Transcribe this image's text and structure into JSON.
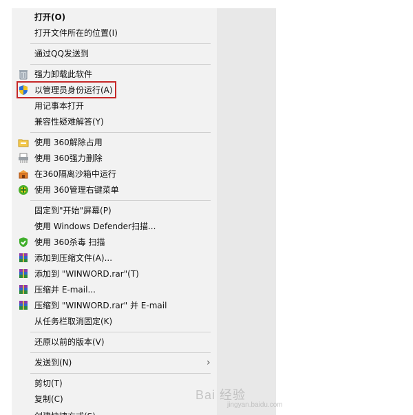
{
  "menu": {
    "items": [
      {
        "label": "打开(O)",
        "icon": "",
        "bold": true
      },
      {
        "label": "打开文件所在的位置(I)",
        "icon": ""
      },
      {
        "label": "通过QQ发送到",
        "icon": ""
      },
      {
        "label": "强力卸载此软件",
        "icon": "trash-icon"
      },
      {
        "label": "以管理员身份运行(A)",
        "icon": "uac-shield-icon"
      },
      {
        "label": "用记事本打开",
        "icon": ""
      },
      {
        "label": "兼容性疑难解答(Y)",
        "icon": ""
      },
      {
        "label": "使用 360解除占用",
        "icon": "folder-unlock-icon"
      },
      {
        "label": "使用 360强力删除",
        "icon": "shredder-icon"
      },
      {
        "label": "在360隔离沙箱中运行",
        "icon": "sandbox-icon"
      },
      {
        "label": "使用 360管理右键菜单",
        "icon": "menu-manager-icon"
      },
      {
        "label": "固定到\"开始\"屏幕(P)",
        "icon": ""
      },
      {
        "label": "使用 Windows Defender扫描...",
        "icon": ""
      },
      {
        "label": "使用 360杀毒 扫描",
        "icon": "antivirus-shield-icon"
      },
      {
        "label": "添加到压缩文件(A)...",
        "icon": "winrar-icon"
      },
      {
        "label": "添加到 \"WINWORD.rar\"(T)",
        "icon": "winrar-icon"
      },
      {
        "label": "压缩并 E-mail...",
        "icon": "winrar-icon"
      },
      {
        "label": "压缩到 \"WINWORD.rar\" 并 E-mail",
        "icon": "winrar-icon"
      },
      {
        "label": "从任务栏取消固定(K)",
        "icon": ""
      },
      {
        "label": "还原以前的版本(V)",
        "icon": ""
      },
      {
        "label": "发送到(N)",
        "icon": "",
        "submenu": true
      },
      {
        "label": "剪切(T)",
        "icon": ""
      },
      {
        "label": "复制(C)",
        "icon": ""
      },
      {
        "label": "创建快捷方式(S)",
        "icon": ""
      }
    ],
    "submenu_arrow": "›"
  },
  "watermark": {
    "text": "Bai 经验",
    "sub": "jingyan.baidu.com"
  },
  "colors": {
    "menu_bg": "#f2f2f2",
    "highlight_border": "#c62828",
    "separator": "#cfcfcf"
  }
}
